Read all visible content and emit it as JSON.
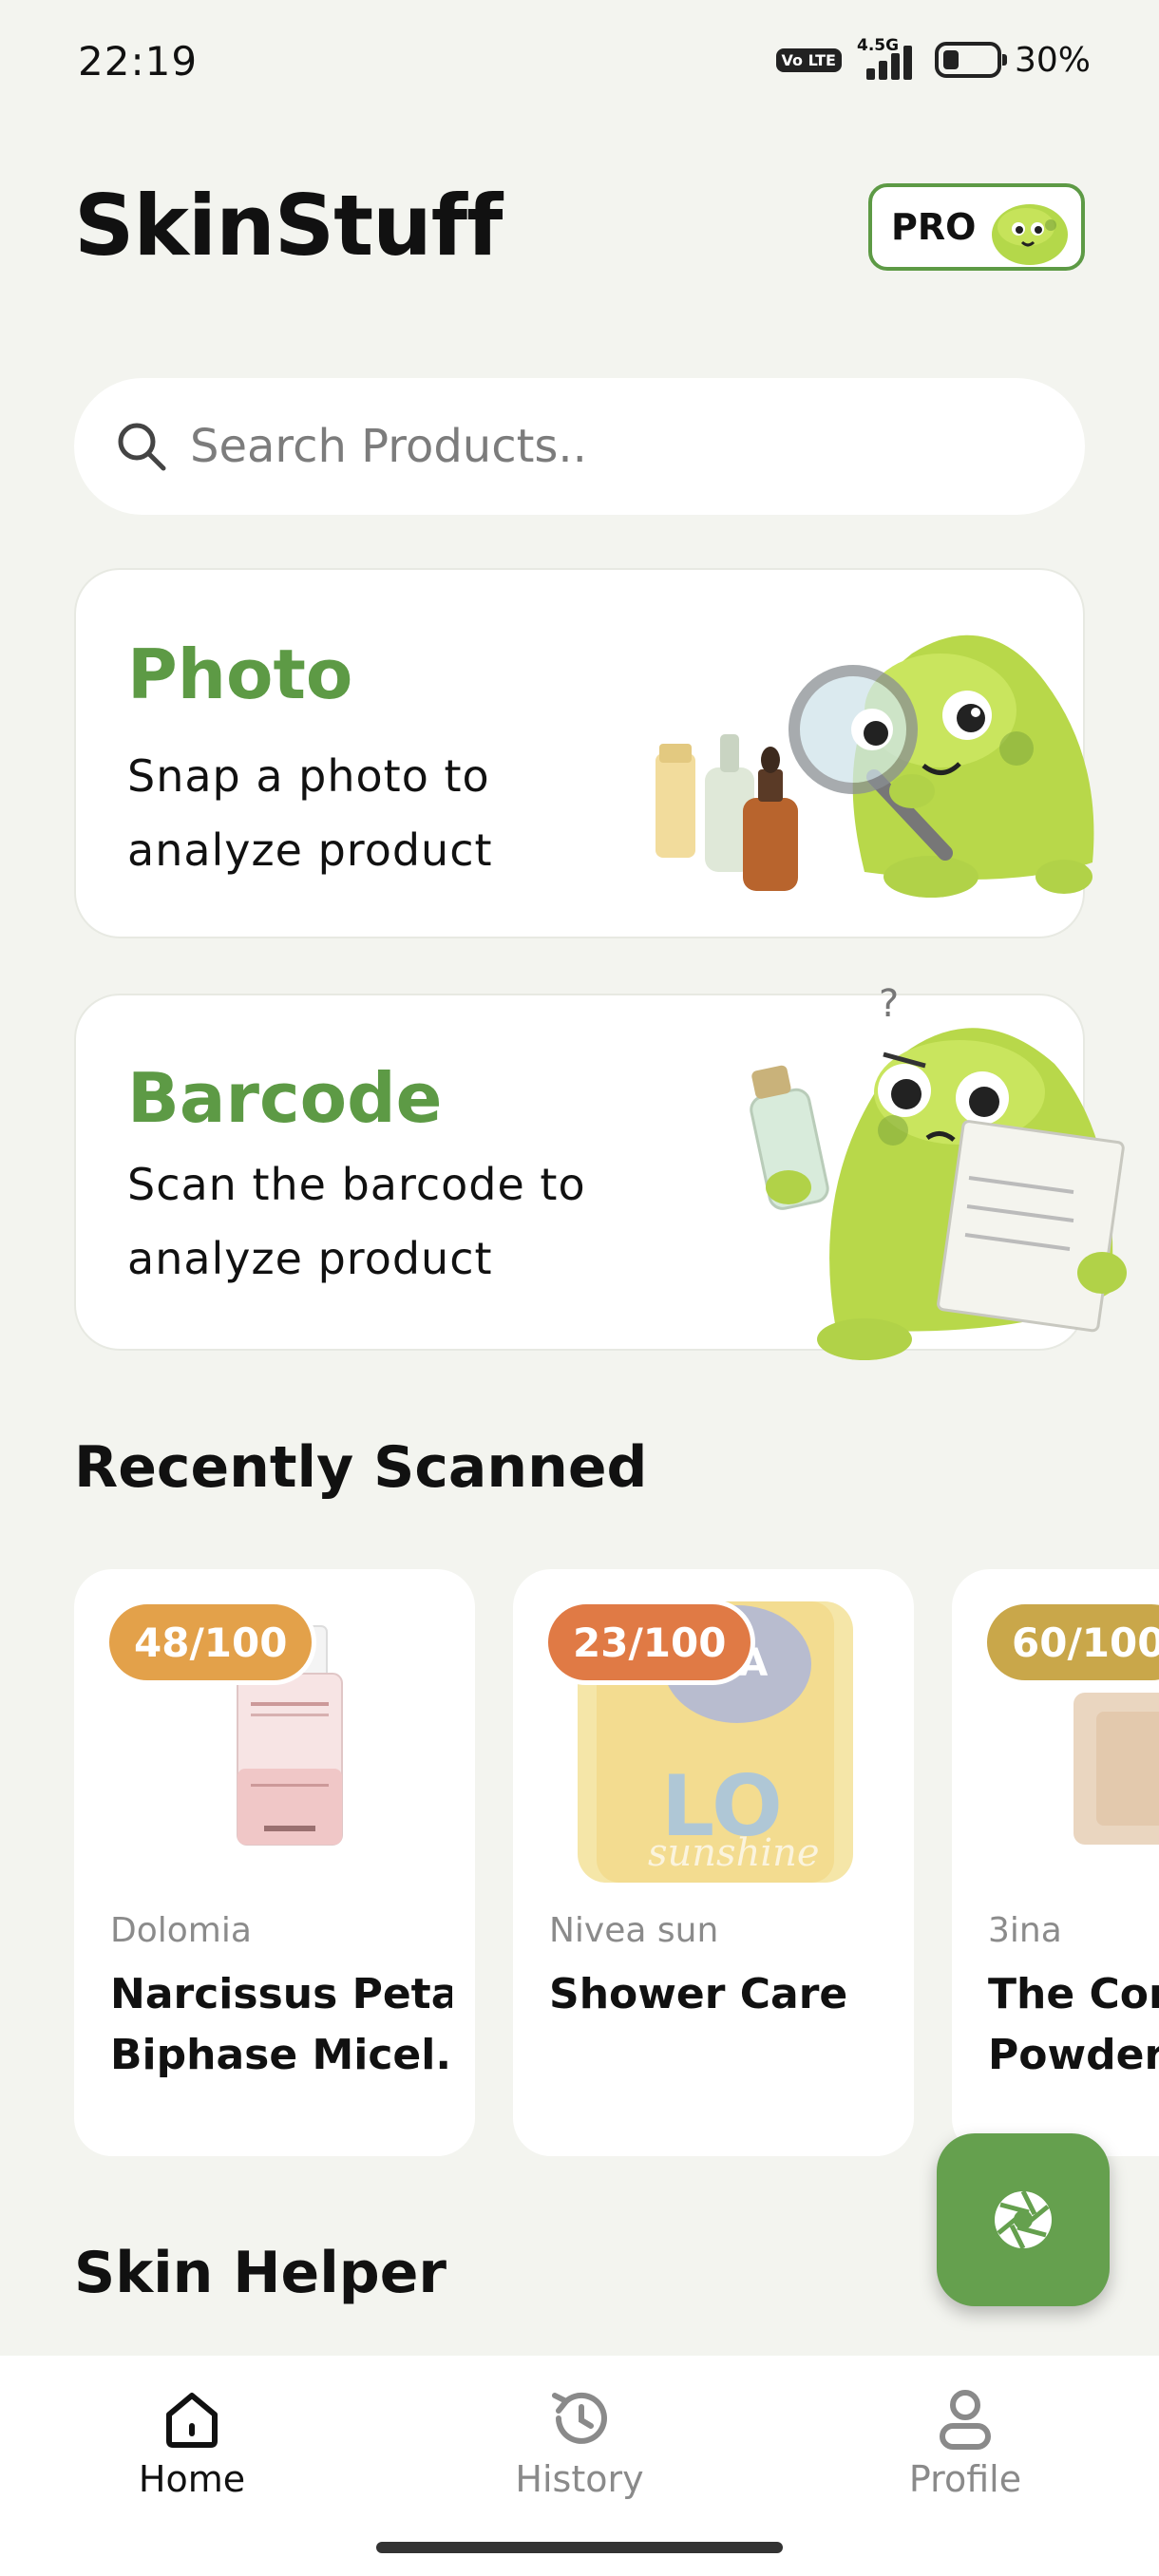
{
  "status_bar": {
    "time": "22:19",
    "volte": "Vo LTE",
    "network": "4.5G",
    "battery": "30%",
    "battery_level": 0.3
  },
  "header": {
    "title": "SkinStuff",
    "pro_label": "PRO"
  },
  "search": {
    "placeholder": "Search Products.."
  },
  "scan_options": [
    {
      "title": "Photo",
      "description_line1": "Snap a photo to",
      "description_line2": "analyze product"
    },
    {
      "title": "Barcode",
      "description_line1": "Scan the barcode to",
      "description_line2": "analyze product"
    }
  ],
  "recently_scanned": {
    "heading": "Recently Scanned",
    "items": [
      {
        "score": "48/100",
        "score_color": "#e3a14a",
        "brand": "Dolomia",
        "name_line1": "Narcissus Petal",
        "name_line2": "Biphase Micel..."
      },
      {
        "score": "23/100",
        "score_color": "#e07a45",
        "brand": "Nivea sun",
        "name_line1": "Shower Care",
        "name_line2": ""
      },
      {
        "score": "60/100",
        "score_color": "#c9a74a",
        "brand": "3ina",
        "name_line1": "The Con",
        "name_line2": "Powder"
      }
    ]
  },
  "skin_helper": {
    "heading": "Skin Helper"
  },
  "bottom_nav": [
    {
      "label": "Home",
      "icon": "home-icon",
      "active": true
    },
    {
      "label": "History",
      "icon": "history-icon",
      "active": false
    },
    {
      "label": "Profile",
      "icon": "profile-icon",
      "active": false
    }
  ],
  "colors": {
    "accent": "#5d9a45",
    "background": "#f3f4ef",
    "fab": "#65a04e"
  }
}
